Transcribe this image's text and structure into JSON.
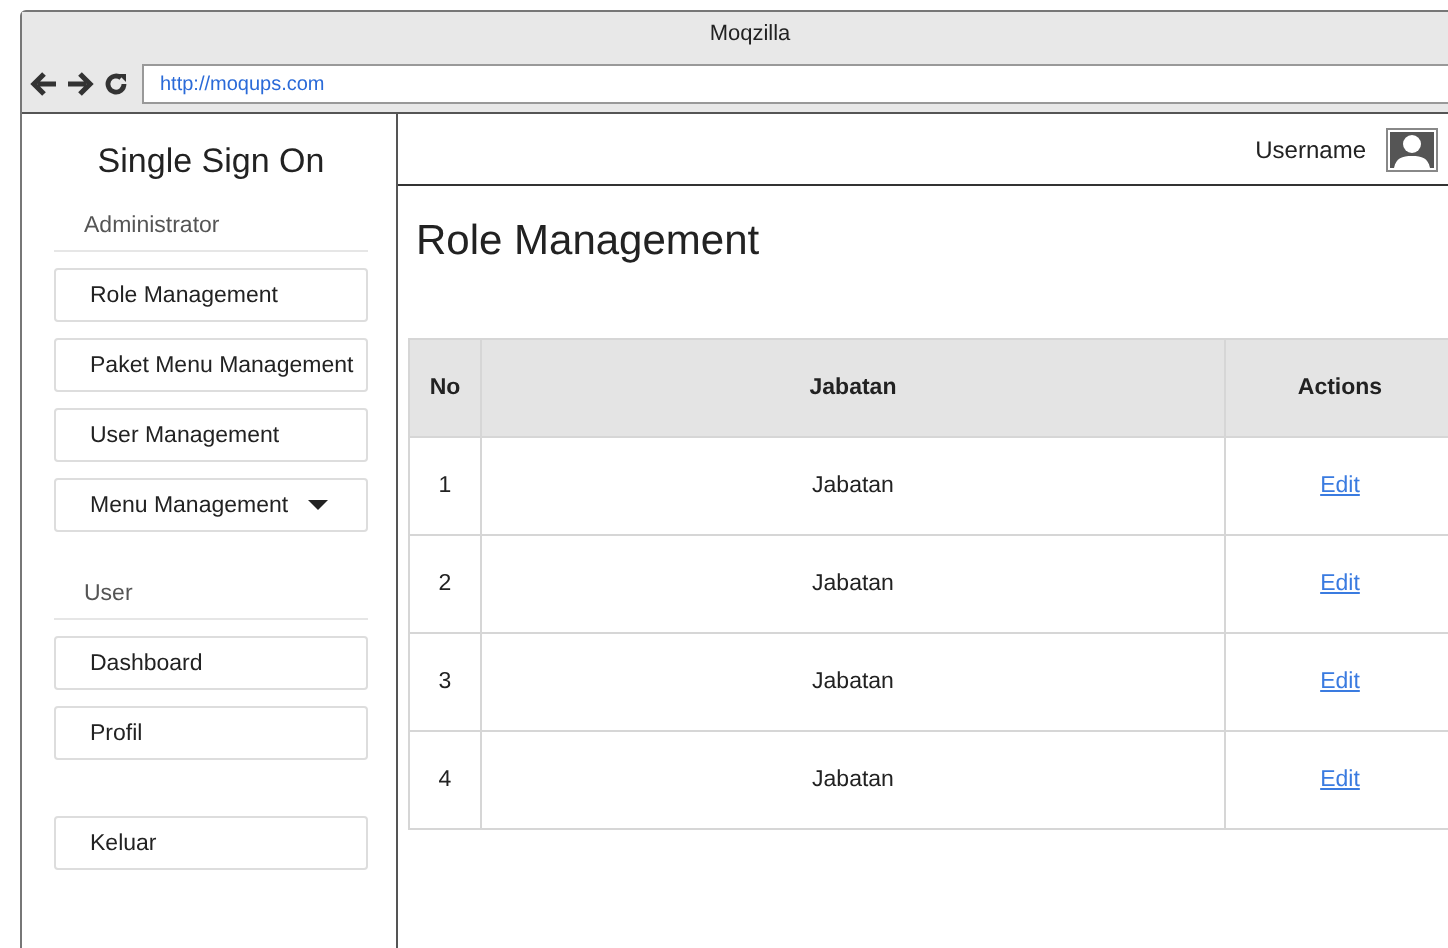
{
  "window": {
    "title": "Moqzilla",
    "url": "http://moqups.com"
  },
  "sidebar": {
    "title": "Single Sign On",
    "sections": [
      {
        "label": "Administrator",
        "items": [
          {
            "label": "Role Management",
            "kind": "link"
          },
          {
            "label": "Paket Menu Management",
            "kind": "link"
          },
          {
            "label": "User Management",
            "kind": "link"
          },
          {
            "label": "Menu Management",
            "kind": "dropdown"
          }
        ]
      },
      {
        "label": "User",
        "items": [
          {
            "label": "Dashboard",
            "kind": "link"
          },
          {
            "label": "Profil",
            "kind": "link"
          }
        ]
      }
    ],
    "logout": "Keluar"
  },
  "header": {
    "username": "Username"
  },
  "page_title": "Role Management",
  "table": {
    "columns": [
      "No",
      "Jabatan",
      "Actions"
    ],
    "rows": [
      {
        "no": "1",
        "jabatan": "Jabatan",
        "action": "Edit"
      },
      {
        "no": "2",
        "jabatan": "Jabatan",
        "action": "Edit"
      },
      {
        "no": "3",
        "jabatan": "Jabatan",
        "action": "Edit"
      },
      {
        "no": "4",
        "jabatan": "Jabatan",
        "action": "Edit"
      }
    ]
  }
}
